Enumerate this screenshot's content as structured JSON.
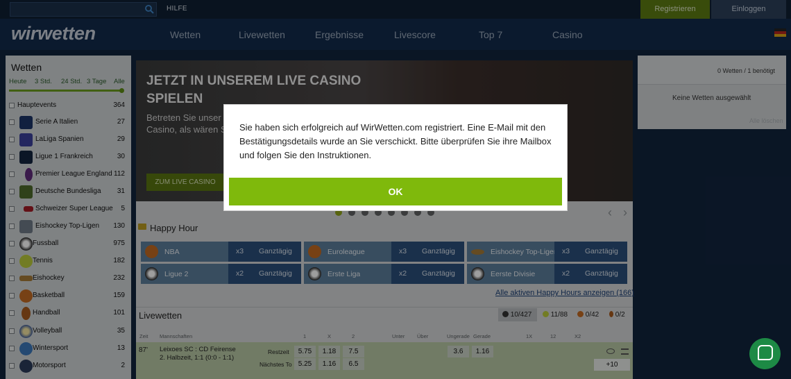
{
  "topbar": {
    "search_placeholder": "",
    "help": "HILFE",
    "register": "Registrieren",
    "login": "Einloggen"
  },
  "header": {
    "logo": "wirwetten",
    "nav": [
      "Wetten",
      "Livewetten",
      "Ergebnisse",
      "Livescore",
      "Top 7",
      "Casino"
    ]
  },
  "sidebar": {
    "title": "Wetten",
    "filters": [
      "Heute",
      "3 Std.",
      "24 Std.",
      "3 Tage",
      "Alle"
    ],
    "items": [
      {
        "label": "Hauptevents",
        "count": "364",
        "icon": "none"
      },
      {
        "label": "Serie A Italien",
        "count": "27",
        "icon": "serie-a-logo"
      },
      {
        "label": "LaLiga Spanien",
        "count": "29",
        "icon": "laliga-logo"
      },
      {
        "label": "Ligue 1 Frankreich",
        "count": "30",
        "icon": "ligue1-logo"
      },
      {
        "label": "Premier League England",
        "count": "112",
        "icon": "premier-league-logo"
      },
      {
        "label": "Deutsche Bundesliga",
        "count": "31",
        "icon": "bundesliga-logo"
      },
      {
        "label": "Schweizer Super League",
        "count": "5",
        "icon": "super-league-logo"
      },
      {
        "label": "Eishockey Top-Ligen",
        "count": "130",
        "icon": "hockey-logo"
      },
      {
        "label": "Fussball",
        "count": "975",
        "icon": "football-icon"
      },
      {
        "label": "Tennis",
        "count": "182",
        "icon": "tennis-ball-icon"
      },
      {
        "label": "Eishockey",
        "count": "232",
        "icon": "hockey-stick-icon"
      },
      {
        "label": "Basketball",
        "count": "159",
        "icon": "basketball-icon"
      },
      {
        "label": "Handball",
        "count": "101",
        "icon": "handball-icon"
      },
      {
        "label": "Volleyball",
        "count": "35",
        "icon": "volleyball-icon"
      },
      {
        "label": "Wintersport",
        "count": "13",
        "icon": "snowflake-icon"
      },
      {
        "label": "Motorsport",
        "count": "2",
        "icon": "motorsport-icon"
      }
    ]
  },
  "banner": {
    "title": "JETZT IN UNSEREM LIVE CASINO SPIELEN",
    "subtitle": "Betreten Sie unser Casino, als wären S",
    "button": "ZUM LIVE CASINO"
  },
  "happy_hour": {
    "title": "Happy Hour",
    "items": [
      {
        "name": "NBA",
        "mult": "x3",
        "type": "Ganztägig",
        "icon": "basketball-icon"
      },
      {
        "name": "Euroleague",
        "mult": "x3",
        "type": "Ganztägig",
        "icon": "basketball-icon"
      },
      {
        "name": "Eishockey Top-Ligen",
        "mult": "x3",
        "type": "Ganztägig",
        "icon": "hockey-stick-icon"
      },
      {
        "name": "Ligue 2",
        "mult": "x2",
        "type": "Ganztägig",
        "icon": "football-icon"
      },
      {
        "name": "Erste Liga",
        "mult": "x2",
        "type": "Ganztägig",
        "icon": "football-icon"
      },
      {
        "name": "Eerste Divisie",
        "mult": "x2",
        "type": "Ganztägig",
        "icon": "football-icon"
      }
    ],
    "all_link": "Alle aktiven Happy Hours anzeigen (166)"
  },
  "livewetten": {
    "title": "Livewetten",
    "stats": [
      "10/427",
      "11/88",
      "0/42",
      "0/2"
    ],
    "columns": [
      "Zeit",
      "Mannschaften",
      "1",
      "X",
      "2",
      "Unter",
      "Über",
      "Ungerade",
      "Gerade",
      "1X",
      "12",
      "X2"
    ],
    "match": {
      "time": "87'",
      "teams": "Leixoes SC : CD Feirense",
      "status": "2. Halbzeit, 1:1  (0:0 - 1:1)",
      "market1": "Restzeit",
      "market2": "Nächstes To",
      "odds1": [
        "5.75",
        "1.18",
        "7.5"
      ],
      "odds2": [
        "5.25",
        "1.16",
        "6.5"
      ],
      "odd_even": [
        "3.6",
        "1.16"
      ],
      "more": "+10"
    }
  },
  "betslip": {
    "count": "0 Wetten / 1 benötigt",
    "empty": "Keine Wetten ausgewählt",
    "delete": "Alle löschen"
  },
  "modal": {
    "message": "Sie haben sich erfolgreich auf WirWetten.com registriert. Eine E-Mail mit den Bestätigungsdetails wurde an Sie verschickt. Bitte überprüfen Sie ihre Mailbox und folgen Sie den Instruktionen.",
    "ok": "OK"
  },
  "colors": {
    "brand_green": "#7fb90c",
    "nav_blue": "#132b4b",
    "happy_hour_dark": "#2b4e79"
  }
}
